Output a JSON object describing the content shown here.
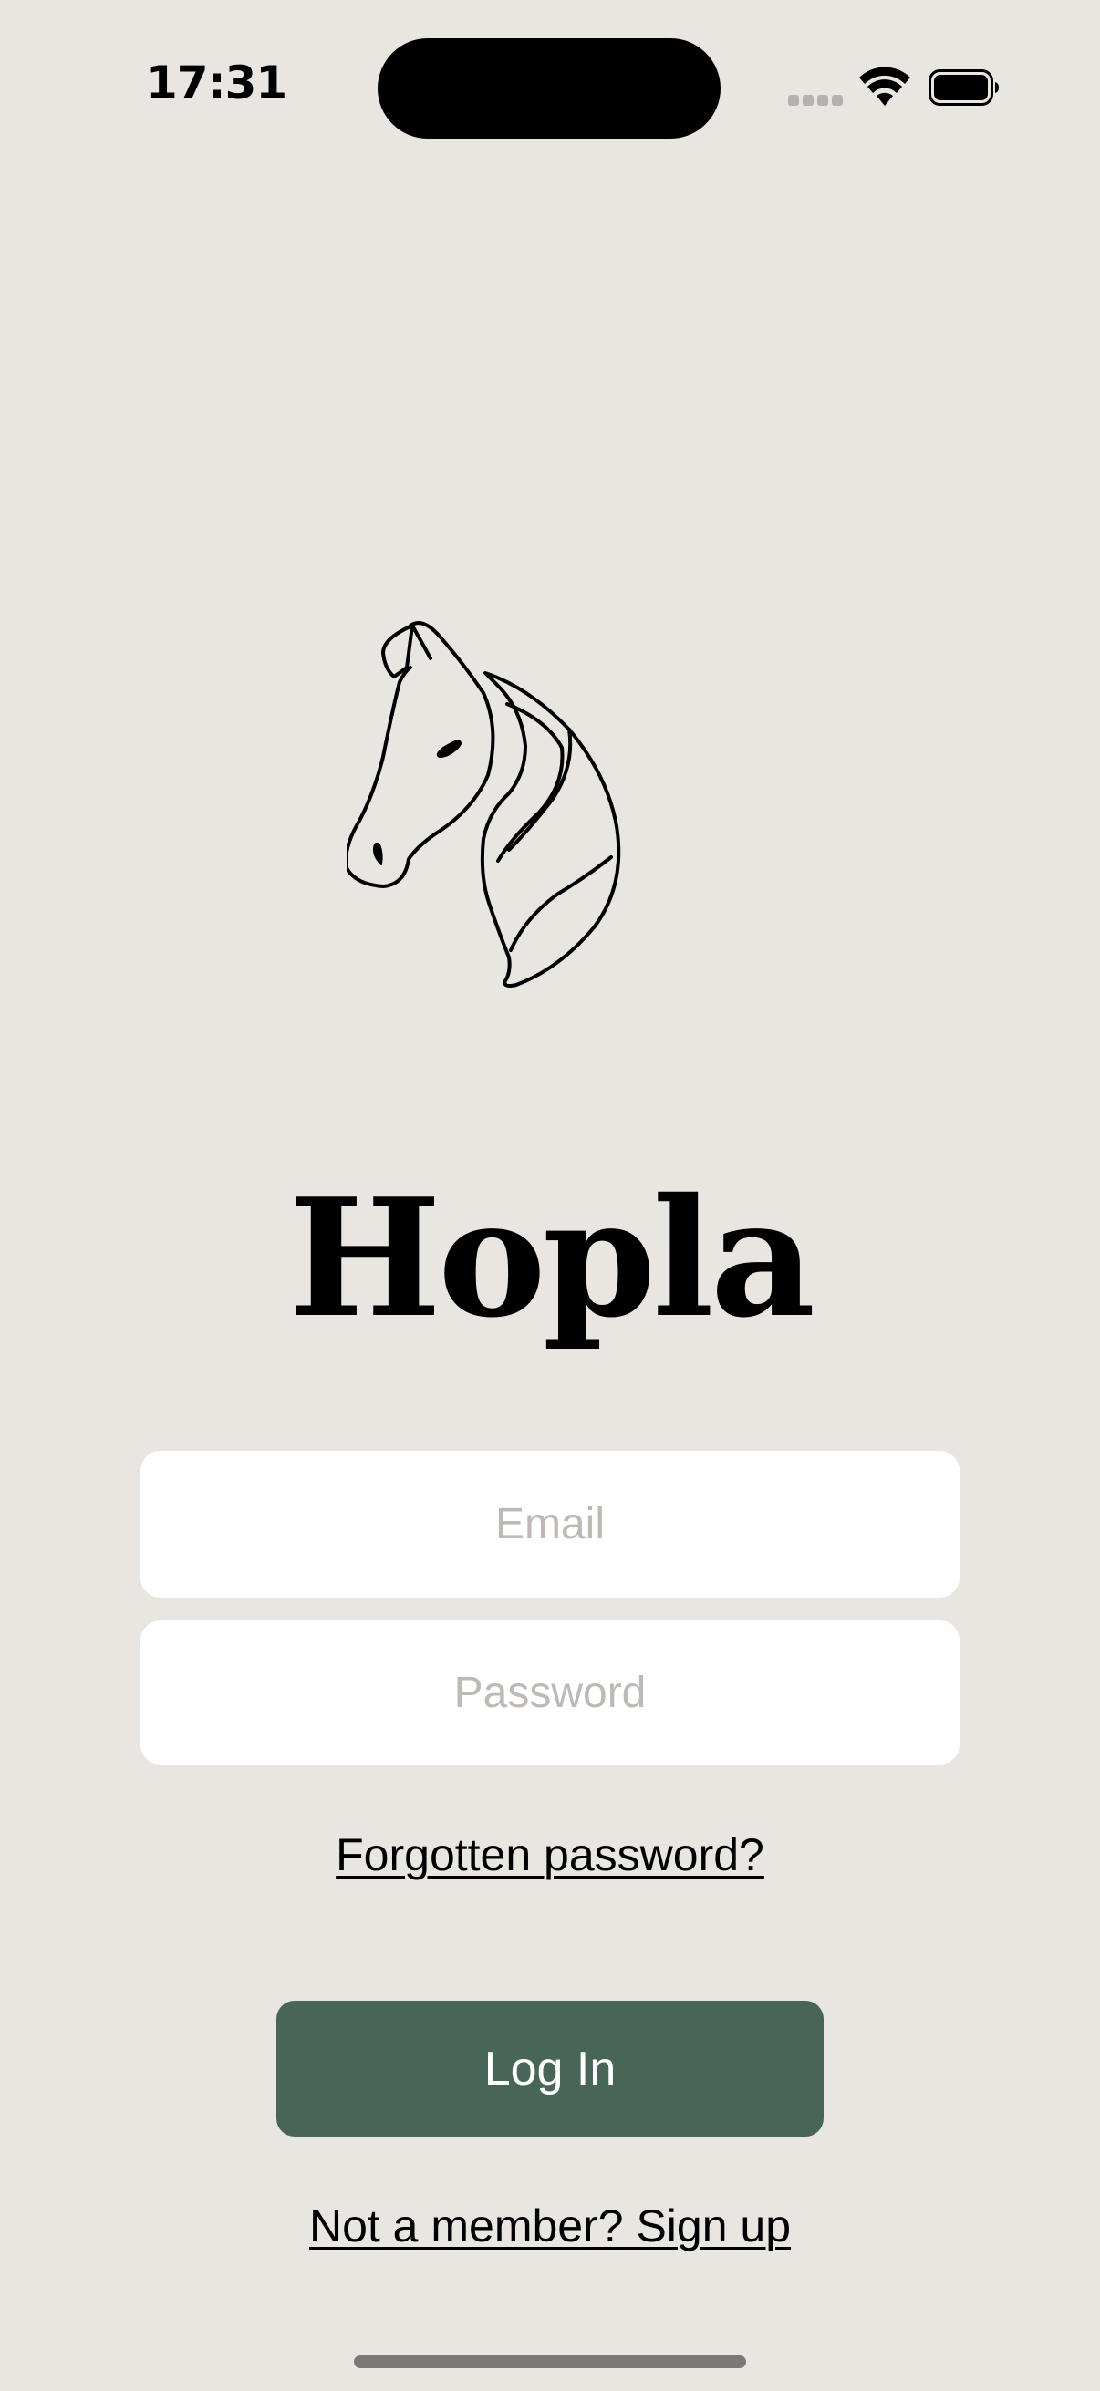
{
  "status_bar": {
    "time": "17:31",
    "icons": [
      "cellular-signal-icon",
      "wifi-icon",
      "battery-icon"
    ]
  },
  "app": {
    "name": "Hopla",
    "logo_icon": "horse-head-icon"
  },
  "login_form": {
    "email_placeholder": "Email",
    "email_value": "",
    "password_placeholder": "Password",
    "password_value": "",
    "forgot_password_label": "Forgotten password?",
    "login_label": "Log In",
    "signup_label": "Not a member? Sign up"
  },
  "colors": {
    "background": "#e9e6e1",
    "primary_button": "#476658",
    "field_background": "#ffffff",
    "placeholder": "#bdbab6"
  }
}
